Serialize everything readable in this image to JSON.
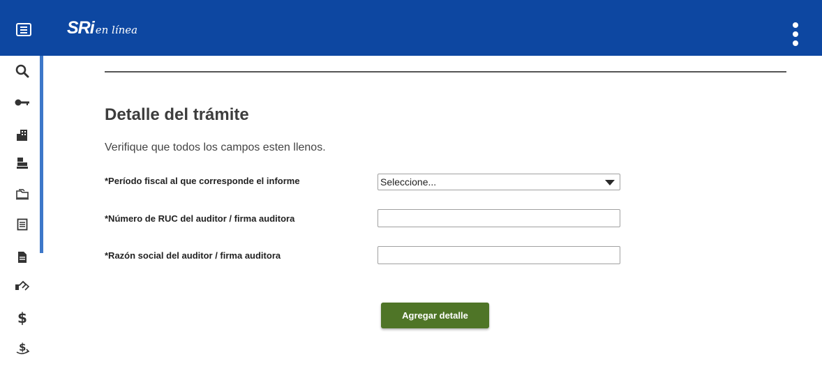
{
  "header": {
    "logo_main": "SRi",
    "logo_sub": "en línea",
    "bg_color": "#0d47a1"
  },
  "sidebar": {
    "icons": [
      {
        "name": "search-icon",
        "glyph": "🔍︎"
      },
      {
        "name": "key-icon",
        "glyph": "⚷"
      },
      {
        "name": "building-icon",
        "glyph": "▙"
      },
      {
        "name": "cash-register-icon",
        "glyph": "▀"
      },
      {
        "name": "folder-icon",
        "glyph": "⌂"
      },
      {
        "name": "document-list-icon",
        "glyph": "▤"
      },
      {
        "name": "file-icon",
        "glyph": "▉"
      },
      {
        "name": "handshake-icon",
        "glyph": "☞"
      },
      {
        "name": "dollar-icon",
        "glyph": "$"
      },
      {
        "name": "dollar-transfer-icon",
        "glyph": "$"
      }
    ]
  },
  "main": {
    "title": "Detalle del trámite",
    "subtitle": "Verifique que todos los campos esten llenos.",
    "fields": {
      "period_label": "*Período fiscal al que corresponde el informe",
      "period_value": "Seleccione...",
      "ruc_label": "*Número de RUC del auditor / firma auditora",
      "ruc_value": "",
      "razon_label": "*Razón social del auditor / firma auditora",
      "razon_value": ""
    },
    "button_label": "Agregar detalle",
    "button_color": "#4f7527"
  }
}
